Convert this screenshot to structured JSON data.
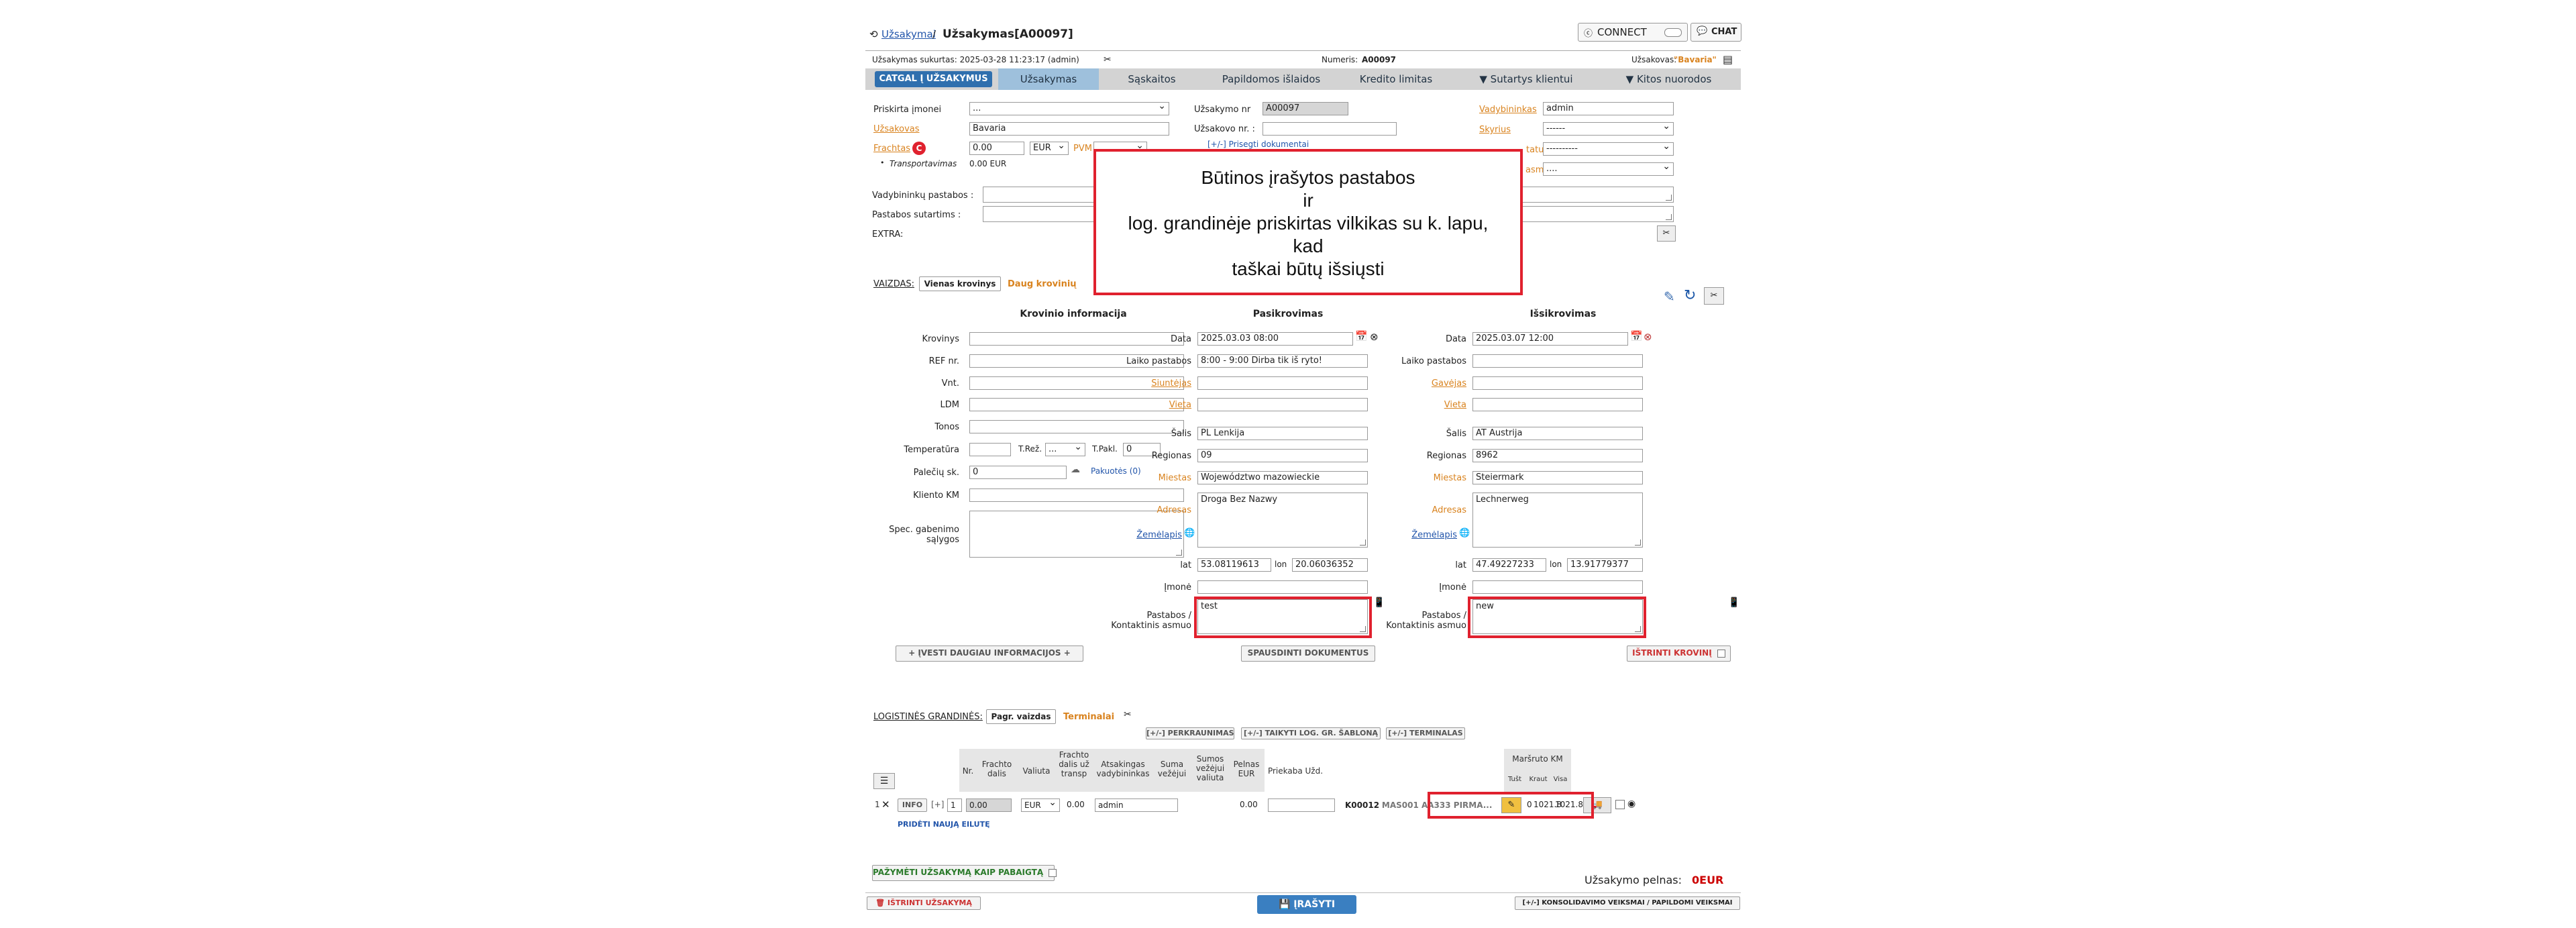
{
  "header": {
    "breadcrumb_link": "Užsakymai",
    "breadcrumb_sep": "/",
    "page_title": "Užsakymas[A00097]",
    "connect_label": "CONNECT",
    "chat_label": "CHAT",
    "created_label": "Užsakymas sukurtas: 2025-03-28 11:23:17 (admin)",
    "number_label": "Numeris:",
    "number_value": "A00097",
    "client_label": "Užsakovas:",
    "client_value": "\"Bavaria\""
  },
  "tabs": {
    "catgal": "CATGAL Į UŽSAKYMUS",
    "items": [
      "Užsakymas",
      "Sąskaitos",
      "Papildomos išlaidos",
      "Kredito limitas",
      "▼ Sutartys klientui",
      "▼ Kitos nuorodos"
    ]
  },
  "form": {
    "company_label": "Priskirta įmonei",
    "company_value": "...",
    "client_label": "Užsakovas",
    "client_value": "Bavaria",
    "freight_label": "Frachtas",
    "freight_badge": "C",
    "freight_value": "0.00",
    "freight_currency": "EUR",
    "vat_label": "PVM",
    "transport_label": "Transportavimas",
    "transport_value": "0.00 EUR",
    "order_nr_label": "Užsakymo nr",
    "order_nr_value": "A00097",
    "client_order_label": "Užsakovo nr. :",
    "client_order_value": "",
    "attach_doc": "[+/-] Prisegti dokumentai",
    "manager_label": "Vadybininkas",
    "manager_value": "admin",
    "dept_label": "Skyrius",
    "dept_value": "------",
    "status_label": "tatusas",
    "status_value": "----------",
    "asmus_label": "asmus",
    "asmus_value": "....",
    "mgr_notes_label": "Vadybininkų pastabos :",
    "contract_notes_label": "Pastabos sutartims :",
    "extra_label": "EXTRA:"
  },
  "overlay": {
    "line1": "Būtinos įrašytos pastabos",
    "line2": "ir",
    "line3": "log. grandinėje priskirtas vilkikas su k. lapu,",
    "line4": "kad",
    "line5": "taškai būtų išsiųsti"
  },
  "view": {
    "label": "VAIZDAS:",
    "single": "Vienas krovinys",
    "multi": "Daug krovinių"
  },
  "cargo": {
    "title": "Krovinio informacija",
    "krovinys": "Krovinys",
    "ref": "REF nr.",
    "vnt": "Vnt.",
    "ldm": "LDM",
    "tonos": "Tonos",
    "temp": "Temperatūra",
    "treg": "T.Rež.",
    "treg_value": "...",
    "tpakl": "T.Pakl.",
    "tpakl_value": "0",
    "pallets": "Palečių sk.",
    "pallets_value": "0",
    "packages": "Pakuotės (0)",
    "client_km": "Kliento KM",
    "spec": "Spec. gabenimo",
    "spec2": "sąlygos",
    "more_info": "+ ĮVESTI DAUGIAU INFORMACIJOS +"
  },
  "loading": {
    "title": "Pasikrovimas",
    "date_label": "Data",
    "date_value": "2025.03.03 08:00",
    "time_notes_label": "Laiko pastabos",
    "time_notes_value": "8:00 - 9:00 Dirba tik iš ryto!",
    "sender_label": "Siuntėjas",
    "place_label": "Vieta",
    "country_label": "Šalis",
    "country_value": "PL Lenkija",
    "region_label": "Regionas",
    "region_value": "09",
    "city_label": "Miestas",
    "city_value": "Województwo mazowieckie",
    "address_label": "Adresas",
    "address_value": "Droga Bez Nazwy",
    "map_label": "Žemėlapis",
    "lat_label": "lat",
    "lat_value": "53.08119613",
    "lon_label": "lon",
    "lon_value": "20.06036352",
    "company_label": "Įmonė",
    "notes_label": "Pastabos /",
    "notes_label2": "Kontaktinis asmuo",
    "notes_value": "test",
    "print_docs": "SPAUSDINTI DOKUMENTUS"
  },
  "unloading": {
    "title": "Išsikrovimas",
    "date_value": "2025.03.07 12:00",
    "receiver_label": "Gavėjas",
    "country_value": "AT Austrija",
    "region_value": "8962",
    "city_value": "Steiermark",
    "address_value": "Lechnerweg",
    "lat_value": "47.49227233",
    "lon_value": "13.91779377",
    "notes_value": "new",
    "delete_cargo": "IŠTRINTI KROVINĮ"
  },
  "logistics": {
    "label": "LOGISTINĖS GRANDINĖS:",
    "main_view": "Pagr. vaizdas",
    "terminals": "Terminalai",
    "btn_trans": "[+/-] PERKRAUNIMAS",
    "btn_template": "[+/-] TAIKYTI LOG. GR. ŠABLONĄ",
    "btn_terminals": "[+/-] TERMINALAS",
    "headers": [
      "Nr.",
      "Frachto dalis",
      "Valiuta",
      "Frachto dalis už transp",
      "Atsakingas vadybininkas",
      "Suma vežėjui",
      "Sumos vežėjui valiuta",
      "Pelnas EUR",
      "Priekaba Užd.",
      "Maršruto KM"
    ],
    "km_sub": [
      "Tušt",
      "Kraut",
      "Visa"
    ],
    "row": {
      "idx": "1",
      "info": "INFO",
      "plus": "[+]",
      "nr": "1",
      "freight": "0.00",
      "currency": "EUR",
      "freight_transp": "0.00",
      "manager": "admin",
      "profit": "0.00",
      "vehicle_code": "K00012",
      "vehicle_rest": "MAS001 AA333 PIRMA...",
      "zero": "0",
      "km1": "1021.8",
      "km2": "1021.8"
    },
    "add_row": "PRIDĖTI NAUJĄ EILUTĘ"
  },
  "footer": {
    "mark_done": "PAŽYMĖTI UŽSAKYMĄ KAIP PABAIGTĄ",
    "profit_label": "Užsakymo pelnas:",
    "profit_value": "0EUR",
    "delete_order": "IŠTRINTI UŽSAKYMĄ",
    "save": "ĮRAŠYTI",
    "consolidate": "[+/-] KONSOLIDAVIMO VEIKSMAI / PAPILDOMI VEIKSMAI"
  }
}
